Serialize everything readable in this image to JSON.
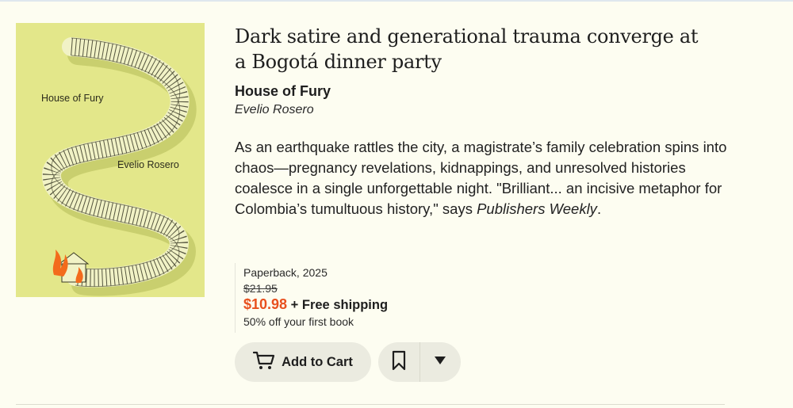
{
  "headline": "Dark satire and generational trauma converge at a Bogotá dinner party",
  "book": {
    "title": "House of Fury",
    "author": "Evelio Rosero",
    "cover_title": "House of Fury",
    "cover_author": "Evelio Rosero",
    "cover_color": "#e3e78a"
  },
  "description": {
    "text": "As an earthquake rattles the city, a magistrate’s family celebration spins into chaos—pregnancy revelations, kidnappings, and unresolved histories coalesce in a single unforgettable night. \"Brilliant... an incisive metaphor for Colombia’s tumultuous history,\" says ",
    "publication": "Publishers Weekly",
    "end": "."
  },
  "purchase": {
    "format": "Paperback, 2025",
    "list_price": "$21.95",
    "sale_price": "$10.98",
    "shipping": "+ Free shipping",
    "promo": "50% off your first book",
    "sale_color": "#e8501e"
  },
  "actions": {
    "add_to_cart": "Add to Cart",
    "cart_icon": "cart-icon",
    "bookmark_icon": "bookmark-icon",
    "dropdown_icon": "caret-down-icon"
  }
}
